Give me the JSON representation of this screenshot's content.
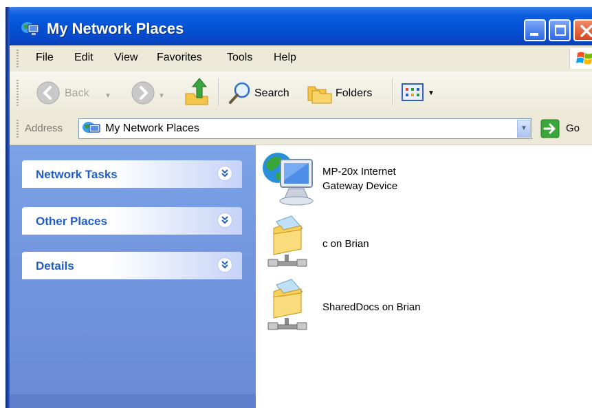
{
  "window": {
    "title": "My Network Places"
  },
  "menubar": {
    "items": [
      "File",
      "Edit",
      "View",
      "Favorites",
      "Tools",
      "Help"
    ]
  },
  "toolbar": {
    "back_label": "Back",
    "search_label": "Search",
    "folders_label": "Folders"
  },
  "addressbar": {
    "label": "Address",
    "value": "My Network Places",
    "go_label": "Go"
  },
  "taskpane": {
    "panels": [
      {
        "title": "Network Tasks"
      },
      {
        "title": "Other Places"
      },
      {
        "title": "Details"
      }
    ]
  },
  "content": {
    "items": [
      {
        "line1": "MP-20x Internet",
        "line2": "Gateway Device",
        "icon": "network-computer-icon"
      },
      {
        "line1": "c on Brian",
        "line2": "",
        "icon": "network-share-folder-icon"
      },
      {
        "line1": "SharedDocs on Brian",
        "line2": "",
        "icon": "network-share-folder-icon"
      }
    ]
  },
  "colors": {
    "titlebar": "#0551d4",
    "taskpane": "#7ba2e7",
    "panel_title": "#215dc6",
    "close_button": "#d6461f"
  }
}
